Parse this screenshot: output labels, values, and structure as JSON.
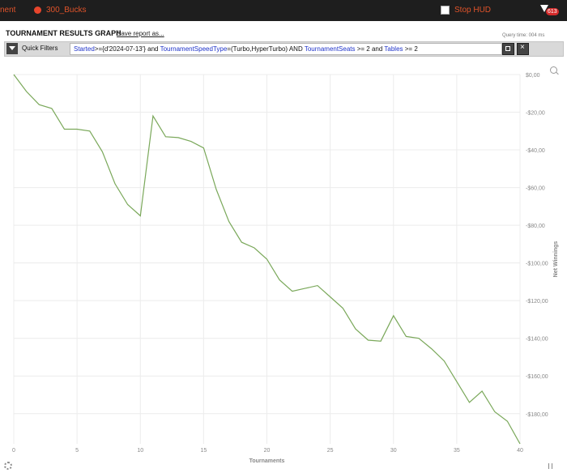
{
  "topbar": {
    "left_text": "nent",
    "user_label": "300_Bucks",
    "stop_hud_label": "Stop HUD",
    "notification_count": "613"
  },
  "header": {
    "title": "TOURNAMENT RESULTS GRAPH",
    "save_label": "Save report as...",
    "query_time": "Query time: 004 ms"
  },
  "filters": {
    "label": "Quick Filters",
    "expression_parts": [
      {
        "text": "Started",
        "keyword": true
      },
      {
        "text": ">={d'2024-07-13'} and ",
        "keyword": false
      },
      {
        "text": "TournamentSpeedType",
        "keyword": true
      },
      {
        "text": "=(Turbo,HyperTurbo) AND ",
        "keyword": false
      },
      {
        "text": "TournamentSeats",
        "keyword": true
      },
      {
        "text": " >= 2 and ",
        "keyword": false
      },
      {
        "text": "Tables",
        "keyword": true
      },
      {
        "text": " >= 2",
        "keyword": false
      }
    ]
  },
  "chart_data": {
    "type": "line",
    "xlabel": "Tournaments",
    "ylabel": "Net Winnings",
    "xlim": [
      0,
      40
    ],
    "ylim": [
      -196,
      0
    ],
    "xticks": [
      0,
      5,
      10,
      15,
      20,
      25,
      30,
      35,
      40
    ],
    "yticks": [
      0,
      -20,
      -40,
      -60,
      -80,
      -100,
      -120,
      -140,
      -160,
      -180
    ],
    "ytick_labels": [
      "$0,00",
      "-$20,00",
      "-$40,00",
      "-$60,00",
      "-$80,00",
      "-$100,00",
      "-$120,00",
      "-$140,00",
      "-$160,00",
      "-$180,00"
    ],
    "grid": true,
    "series": [
      {
        "color": "#7aa85a",
        "x": [
          0,
          1,
          2,
          3,
          4,
          5,
          6,
          7,
          8,
          9,
          10,
          11,
          12,
          13,
          14,
          15,
          16,
          17,
          18,
          19,
          20,
          21,
          22,
          23,
          24,
          25,
          26,
          27,
          28,
          29,
          30,
          31,
          32,
          33,
          34,
          35,
          36,
          37,
          38,
          39,
          40
        ],
        "y": [
          0,
          -9,
          -16,
          -18,
          -29,
          -29,
          -30,
          -41,
          -58,
          -69,
          -75,
          -22,
          -33,
          -33.5,
          -35.5,
          -39,
          -61,
          -78,
          -89,
          -92,
          -98,
          -109,
          -115,
          -113.5,
          -112,
          -118,
          -124,
          -135,
          -141,
          -141.5,
          -128,
          -139,
          -140,
          -145.5,
          -152,
          -163,
          -174,
          -168,
          -179,
          -184,
          -196
        ]
      }
    ]
  }
}
